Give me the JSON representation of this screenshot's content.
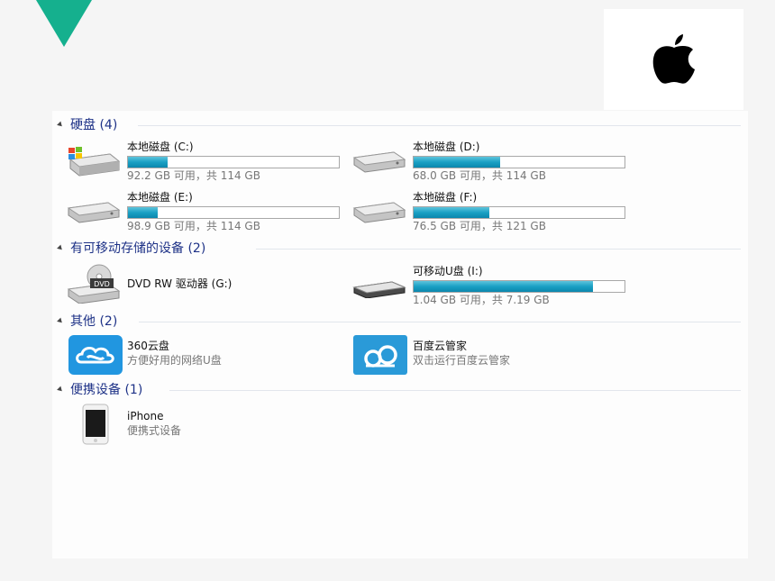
{
  "sections": [
    {
      "title": "硬盘 (4)"
    },
    {
      "title": "有可移动存储的设备 (2)"
    },
    {
      "title": "其他 (2)"
    },
    {
      "title": "便携设备 (1)"
    }
  ],
  "drives": [
    {
      "name": "本地磁盘 (C:)",
      "info": "92.2 GB 可用，共 114 GB",
      "used_fraction": 0.19
    },
    {
      "name": "本地磁盘 (D:)",
      "info": "68.0 GB 可用，共 114 GB",
      "used_fraction": 0.41
    },
    {
      "name": "本地磁盘 (E:)",
      "info": "98.9 GB 可用，共 114 GB",
      "used_fraction": 0.14
    },
    {
      "name": "本地磁盘 (F:)",
      "info": "76.5 GB 可用，共 121 GB",
      "used_fraction": 0.36
    }
  ],
  "removable": [
    {
      "name": "DVD RW 驱动器 (G:)",
      "badge": "DVD"
    },
    {
      "name": "可移动U盘 (I:)",
      "info": "1.04 GB 可用，共 7.19 GB",
      "used_fraction": 0.85
    }
  ],
  "other": [
    {
      "name": "360云盘",
      "desc": "方便好用的网络U盘"
    },
    {
      "name": "百度云管家",
      "desc": "双击运行百度云管家"
    }
  ],
  "portable": [
    {
      "name": "iPhone",
      "desc": "便携式设备"
    }
  ],
  "colors": {
    "accent": "#15b08e",
    "section_title": "#1e3287",
    "bar_fill": "#1aa0c4"
  }
}
